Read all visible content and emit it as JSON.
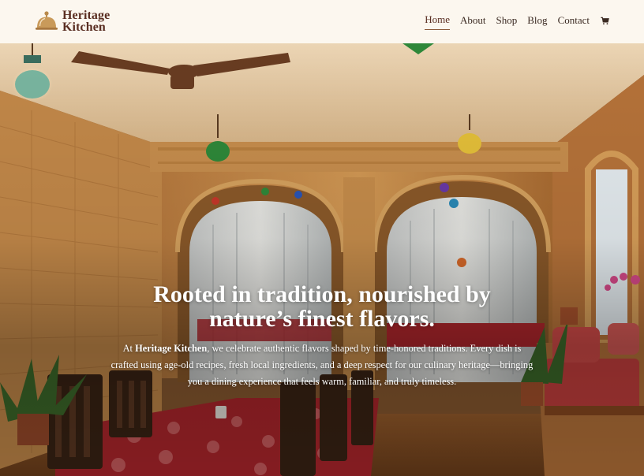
{
  "brand": {
    "line1": "Heritage",
    "line2": "Kitchen",
    "icon": "cloche-icon",
    "color": "#5a2e22",
    "icon_color": "#b98a4c"
  },
  "nav": {
    "items": [
      {
        "label": "Home",
        "active": true
      },
      {
        "label": "About",
        "active": false
      },
      {
        "label": "Shop",
        "active": false
      },
      {
        "label": "Blog",
        "active": false
      },
      {
        "label": "Contact",
        "active": false
      }
    ],
    "cart_icon": "cart-icon"
  },
  "hero": {
    "headline": "Rooted in tradition, nourished by nature’s finest flavors.",
    "lead_prefix": "At ",
    "lead_brand": "Heritage Kitchen",
    "lead_rest": ", we celebrate authentic flavors shaped by time-honored traditions. Every dish is crafted using age-old recipes, fresh local ingredients, and a deep respect for our culinary heritage—bringing you a dining experience that feels warm, familiar, and truly timeless.",
    "background": "restaurant interior with sandstone walls, carved arches, hanging lanterns and long tables with red floral tablecloths",
    "text_color": "#ffffff"
  }
}
